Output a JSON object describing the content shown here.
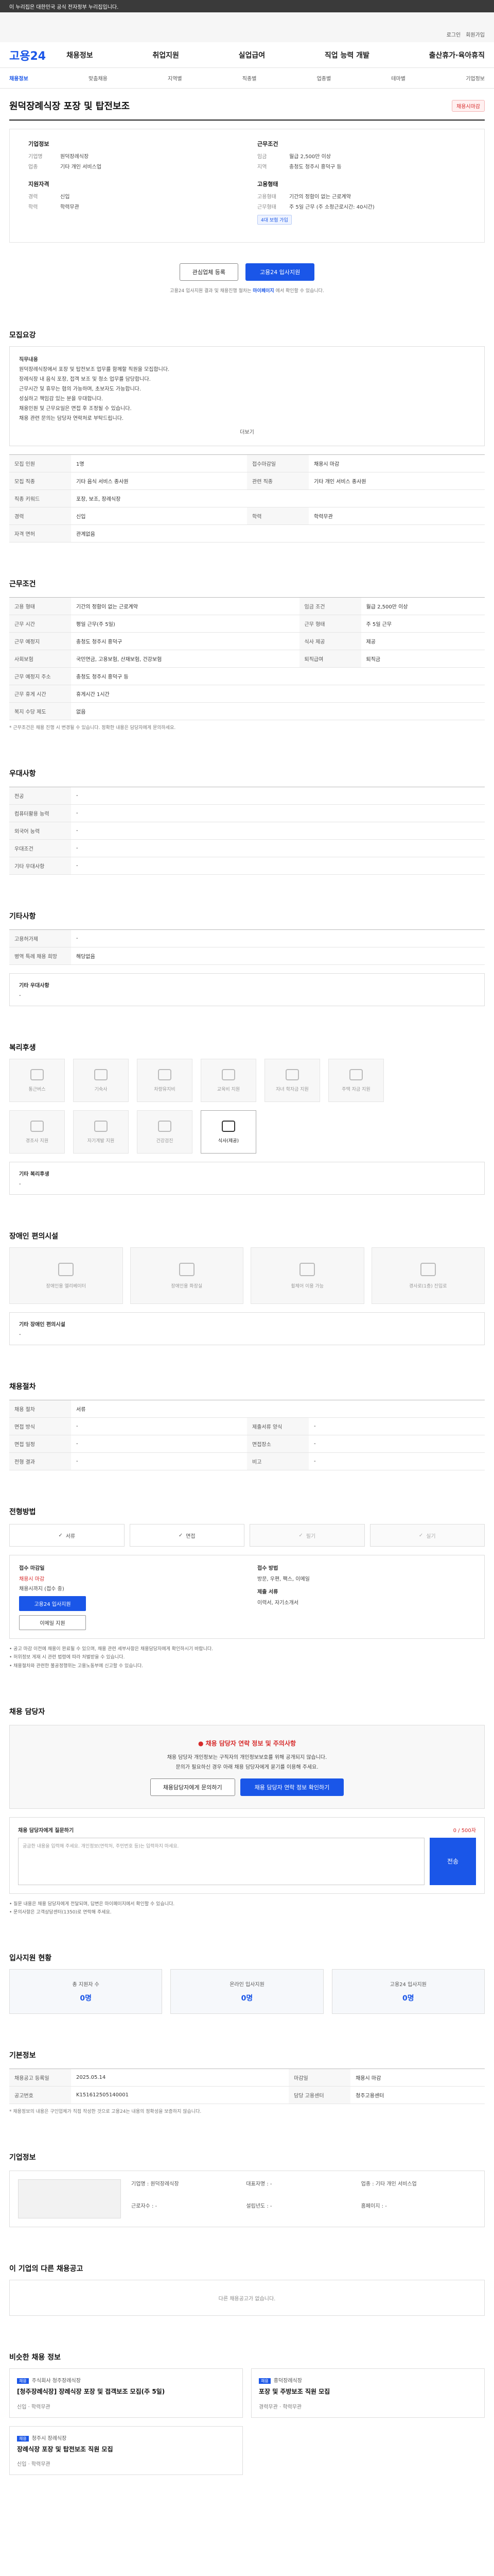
{
  "topbar": {
    "text": "이 누리집은 대한민국 공식 전자정부 누리집입니다."
  },
  "gov": {
    "links": [
      "로그인",
      "회원가입"
    ]
  },
  "logo": {
    "main": "고용",
    "num": "24"
  },
  "nav": [
    "채용정보",
    "취업지원",
    "실업급여",
    "직업 능력 개발",
    "출산휴가·육아휴직"
  ],
  "subnav": [
    "채용정보",
    "맞춤채용",
    "지역별",
    "직종별",
    "업종별",
    "테마별",
    "기업정보"
  ],
  "job": {
    "title": "원덕장례식장 포장 및 탑전보조",
    "badge": "채용시마감"
  },
  "summary": {
    "company_h": "기업정보",
    "company_rows": [
      {
        "k": "기업명",
        "v": "원덕장례식장"
      },
      {
        "k": "업종",
        "v": "기타 개인 서비스업"
      }
    ],
    "cond_h": "근무조건",
    "cond_rows": [
      {
        "k": "임금",
        "v": "월급 2,500만 이상"
      },
      {
        "k": "지역",
        "v": "충청도 청주시 흥덕구 등"
      }
    ],
    "career_h": "지원자격",
    "career_rows": [
      {
        "k": "경력",
        "v": "신입"
      },
      {
        "k": "학력",
        "v": "학력무관"
      }
    ],
    "type_h": "고용형태",
    "type_rows": [
      {
        "k": "고용형태",
        "v": "기간의 정함이 없는 근로계약"
      },
      {
        "k": "근무형태",
        "v": "주 5일 근무 (주 소정근로시간: 40시간)"
      }
    ],
    "tag": "4대 보험 가입"
  },
  "actions": {
    "save": "관심업체 등록",
    "apply": "고용24 입사지원",
    "note": "고용24 입사지원 결과 및 채용진행 절차는",
    "note_link": "마이페이지",
    "note_tail": "에서 확인할 수 있습니다."
  },
  "recruit": {
    "title": "모집요강",
    "content_h": "직무내용",
    "lines": [
      "원덕장례식장에서 포장 및 탑전보조 업무를 함께할 직원을 모집합니다.",
      "장례식장 내 음식 포장, 접객 보조 및 청소 업무를 담당합니다.",
      "근무시간 및 휴무는 협의 가능하며, 초보자도 가능합니다.",
      "성실하고 책임감 있는 분을 우대합니다.",
      "채용인원 및 근무요일은 면접 후 조정될 수 있습니다.",
      "채용 관련 문의는 담당자 연락처로 부탁드립니다."
    ],
    "more": "더보기",
    "table": [
      {
        "k1": "모집 인원",
        "v1": "1명",
        "k2": "접수마감일",
        "v2": "채용시 마감"
      },
      {
        "k1": "모집 직종",
        "v1": "기타 음식 서비스 종사원",
        "k2": "관련 직종",
        "v2": "기타 개인 서비스 종사원"
      },
      {
        "k1": "직종 키워드",
        "v1": "포장, 보조, 장례식장",
        "k2": "",
        "v2": ""
      },
      {
        "k1": "경력",
        "v1": "신입",
        "k2": "학력",
        "v2": "학력무관"
      },
      {
        "k1": "자격 면허",
        "v1": "관계없음",
        "k2": "",
        "v2": ""
      }
    ]
  },
  "work": {
    "title": "근무조건",
    "table": [
      {
        "k1": "고용 형태",
        "v1": "기간의 정함이 없는 근로계약",
        "k2": "임금 조건",
        "v2": "월급 2,500만 이상"
      },
      {
        "k1": "근무 시간",
        "v1": "평일 근무(주 5일)",
        "k2": "근무 형태",
        "v2": "주 5일 근무"
      },
      {
        "k1": "근무 예정지",
        "v1": "충청도 청주시 흥덕구",
        "k2": "식사 제공",
        "v2": "제공"
      },
      {
        "k1": "사회보험",
        "v1": "국민연금, 고용보험, 산재보험, 건강보험",
        "k2": "퇴직급여",
        "v2": "퇴직금"
      },
      {
        "k1": "근무 예정지 주소",
        "v1": "충청도 청주시 흥덕구 등",
        "k2": "",
        "v2": ""
      },
      {
        "k1": "근무 휴게 시간",
        "v1": "휴게시간 1시간",
        "k2": "",
        "v2": ""
      },
      {
        "k1": "복지 수당 제도",
        "v1": "없음",
        "k2": "",
        "v2": ""
      }
    ],
    "note": "* 근무조건은 채용 진행 시 변경될 수 있습니다. 정확한 내용은 담당자에게 문의하세요."
  },
  "extra": {
    "title": "우대사항",
    "rows": [
      {
        "k": "전공",
        "v": "-"
      },
      {
        "k": "컴퓨터활용 능력",
        "v": "-"
      },
      {
        "k": "외국어 능력",
        "v": "-"
      },
      {
        "k": "우대조건",
        "v": "-"
      },
      {
        "k": "기타 우대사항",
        "v": "-"
      }
    ]
  },
  "etc": {
    "title": "기타사항",
    "rows": [
      {
        "k": "고용허가제",
        "v": "-"
      },
      {
        "k": "병역 특례 채용 희망",
        "v": "해당없음"
      }
    ],
    "note_h": "기타 우대사항",
    "note_v": "-"
  },
  "welfare": {
    "title": "복리후생",
    "items": [
      "통근버스",
      "기숙사",
      "차량유지비",
      "교육비 지원",
      "자녀 학자금 지원",
      "주택 자금 지원",
      "경조사 지원",
      "자기계발 지원",
      "건강검진",
      "식사(제공)"
    ],
    "other_h": "기타 복리후생",
    "other_v": "-"
  },
  "disabled": {
    "title": "장애인 편의시설",
    "items": [
      "장애인용 엘리베이터",
      "장애인용 화장실",
      "휠체어 이용 가능",
      "경사로(1층) 진입로"
    ],
    "other_h": "기타 장애인 편의시설",
    "other_v": "-"
  },
  "process": {
    "title": "채용절차",
    "table": [
      {
        "k1": "채용 절차",
        "v1": "서류",
        "k2": "",
        "v2": ""
      },
      {
        "k1": "면접 방식",
        "v1": "-",
        "k2": "제출서류 양식",
        "v2": "-"
      },
      {
        "k1": "면접 일정",
        "v1": "-",
        "k2": "면접장소",
        "v2": "-"
      },
      {
        "k1": "전형 결과",
        "v1": "-",
        "k2": "비고",
        "v2": "-"
      }
    ]
  },
  "apply": {
    "title": "전형방법",
    "methods": [
      "서류",
      "면접",
      "필기",
      "실기"
    ],
    "deadline_k": "접수 마감일",
    "deadline_v": "채용시 마감",
    "remain": "채용시까지 (접수 중)",
    "apply_btn": "고용24 입사지원",
    "email_btn": "이메일 지원",
    "method_k": "접수 방법",
    "method_v": "방문, 우편, 팩스, 이메일",
    "docs_k": "제출 서류",
    "docs_v": "이력서, 자기소개서",
    "notes": [
      "• 공고 마감 이전에 채용이 완료될 수 있으며, 채용 관련 세부사항은 채용담당자에게 확인하시기 바랍니다.",
      "• 허위정보 게재 시 관련 법령에 따라 처벌받을 수 있습니다.",
      "• 채용절차와 관련한 불공정행위는 고용노동부에 신고할 수 있습니다."
    ]
  },
  "contact": {
    "title": "채용 담당자",
    "warn_title": "채용 담당자 연락 정보 및 주의사항",
    "warn_lines": [
      "채용 담당자 개인정보는 구직자의 개인정보보호를 위해 공개되지 않습니다.",
      "문의가 필요하신 경우 아래 채용 담당자에게 묻기를 이용해 주세요."
    ],
    "btn1": "채용담당자에게 문의하기",
    "btn2": "채용 담당자 연락 정보 확인하기",
    "qa_h": "채용 담당자에게 질문하기",
    "qa_cnt": "0 / 500자",
    "qa_placeholder": "궁금한 내용을 입력해 주세요. 개인정보(연락처, 주민번호 등)는 입력하지 마세요.",
    "qa_send": "전송",
    "notes": [
      "• 질문 내용은 채용 담당자에게 전달되며, 답변은 마이페이지에서 확인할 수 있습니다.",
      "• 문의사항은 고객상담센터(1350)로 연락해 주세요."
    ]
  },
  "status": {
    "title": "입사지원 현황",
    "items": [
      {
        "k": "총 지원자 수",
        "v": "0명"
      },
      {
        "k": "온라인 입사지원",
        "v": "0명"
      },
      {
        "k": "고용24 입사지원",
        "v": "0명"
      }
    ]
  },
  "info": {
    "title": "기본정보",
    "table": [
      {
        "k1": "채용공고 등록일",
        "v1": "2025.05.14",
        "k2": "마감일",
        "v2": "채용시 마감"
      },
      {
        "k1": "공고번호",
        "v1": "K151612505140001",
        "k2": "담당 고용센터",
        "v2": "청주고용센터"
      }
    ],
    "note": "* 채용정보의 내용은 구인업체가 직접 작성한 것으로 고용24는 내용의 정확성을 보증하지 않습니다."
  },
  "company": {
    "title": "기업정보",
    "rows": [
      {
        "k": "기업명",
        "v": "원덕장례식장"
      },
      {
        "k": "대표자명",
        "v": "-"
      },
      {
        "k": "업종",
        "v": "기타 개인 서비스업"
      },
      {
        "k": "근로자수",
        "v": "-"
      },
      {
        "k": "설립년도",
        "v": "-"
      },
      {
        "k": "홈페이지",
        "v": "-"
      }
    ]
  },
  "other_jobs": {
    "title": "이 기업의 다른 채용공고",
    "empty": "다른 채용공고가 없습니다."
  },
  "recommend": {
    "title": "비슷한 채용 정보",
    "items": [
      {
        "badge": "채용",
        "co": "주식회사 청주장례식장",
        "t": "[청주장례식장] 장례식장 포장 및 접객보조 모집(주 5일)",
        "m": "신입 · 학력무관"
      },
      {
        "badge": "채용",
        "co": "흥덕장례식장",
        "t": "포장 및 주방보조 직원 모집",
        "m": "경력무관 · 학력무관"
      },
      {
        "badge": "채용",
        "co": "청주시 장례식장",
        "t": "장례식장 포장 및 탑전보조 직원 모집",
        "m": "신입 · 학력무관"
      }
    ]
  }
}
